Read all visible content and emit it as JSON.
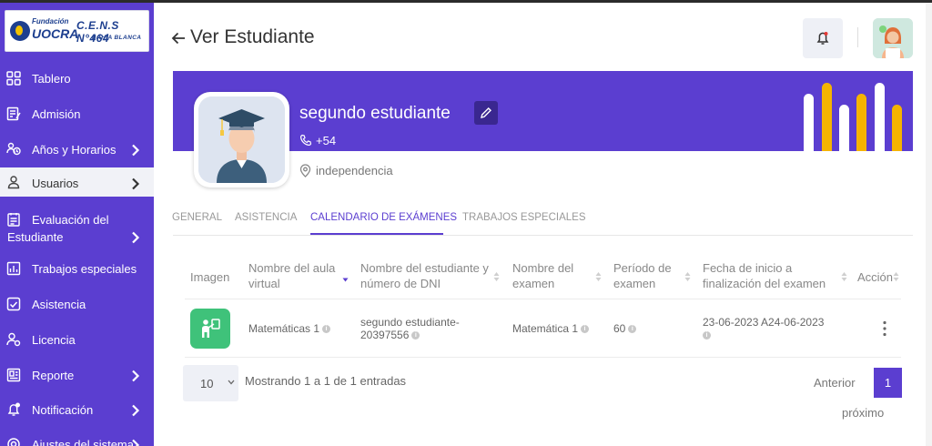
{
  "logo": {
    "fundacion": "Fundación",
    "uocra": "UOCRA",
    "cens": "C.E.N.S N°464",
    "city": "BAHÍA BLANCA"
  },
  "sidebar": {
    "items": [
      {
        "label": "Tablero",
        "icon": "dashboard-icon"
      },
      {
        "label": "Admisión",
        "icon": "admission-icon"
      },
      {
        "label": "Años y Horarios",
        "icon": "schedule-icon"
      },
      {
        "label": "Usuarios",
        "icon": "user-icon"
      },
      {
        "label": "Evaluación del",
        "label2": "Estudiante",
        "icon": "evaluation-icon"
      },
      {
        "label": "Trabajos especiales",
        "icon": "special-works-icon"
      },
      {
        "label": "Asistencia",
        "icon": "attendance-icon"
      },
      {
        "label": "Licencia",
        "icon": "license-icon"
      },
      {
        "label": "Reporte",
        "icon": "report-icon"
      },
      {
        "label": "Notificación",
        "icon": "notification-icon"
      },
      {
        "label": "Ajustes del sistema",
        "icon": "settings-icon"
      }
    ]
  },
  "header": {
    "title": "Ver Estudiante"
  },
  "profile": {
    "name": "segundo estudiante",
    "phone": "+54",
    "location": "independencia"
  },
  "tabs": [
    {
      "label": "GENERAL"
    },
    {
      "label": "ASISTENCIA"
    },
    {
      "label": "CALENDARIO DE EXÁMENES"
    },
    {
      "label": "TRABAJOS ESPECIALES"
    }
  ],
  "table": {
    "headers": {
      "image": "Imagen",
      "classroom": "Nombre del aula virtual",
      "student": "Nombre del estudiante y número de DNI",
      "exam": "Nombre del examen",
      "period": "Período de examen",
      "dates": "Fecha de inicio a finalización del examen",
      "action": "Acción"
    },
    "rows": [
      {
        "classroom": "Matemáticas 1",
        "student_name": "segundo estudiante-",
        "student_dni": "20397556",
        "exam": "Matemática 1",
        "period": "60",
        "dates": "23-06-2023 A24-06-2023"
      }
    ]
  },
  "pagination": {
    "page_size": "10",
    "showing": "Mostrando 1 a 1 de 1 entradas",
    "prev": "Anterior",
    "current": "1",
    "next": "próximo"
  },
  "colors": {
    "primary": "#5b3ed0",
    "accent": "#f5b400",
    "success": "#3fc27a"
  }
}
